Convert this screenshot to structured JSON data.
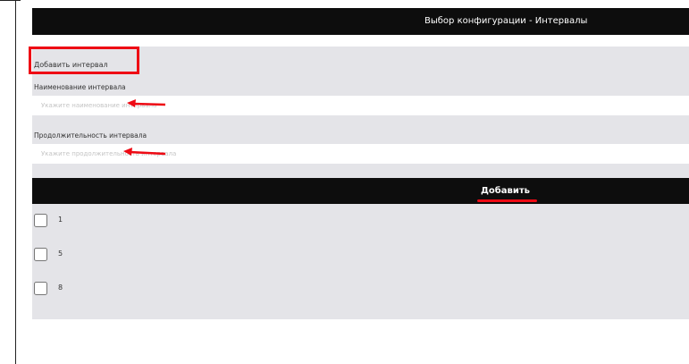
{
  "header": {
    "title": "Выбор конфигурации - Интервалы"
  },
  "form": {
    "section_title": "Добавить интервал",
    "name_field": {
      "label": "Наименование интервала",
      "placeholder": "Укажите наименование интервала",
      "value": ""
    },
    "duration_field": {
      "label": "Продолжительность интервала",
      "placeholder": "Укажите продолжительность интервала",
      "value": ""
    },
    "add_button_label": "Добавить"
  },
  "intervals": [
    {
      "label": "1",
      "checked": false
    },
    {
      "label": "5",
      "checked": false
    },
    {
      "label": "8",
      "checked": false
    }
  ],
  "colors": {
    "header_bg": "#0d0d0d",
    "panel_bg": "#e4e4e8",
    "annotation_red": "#ee0a14"
  }
}
